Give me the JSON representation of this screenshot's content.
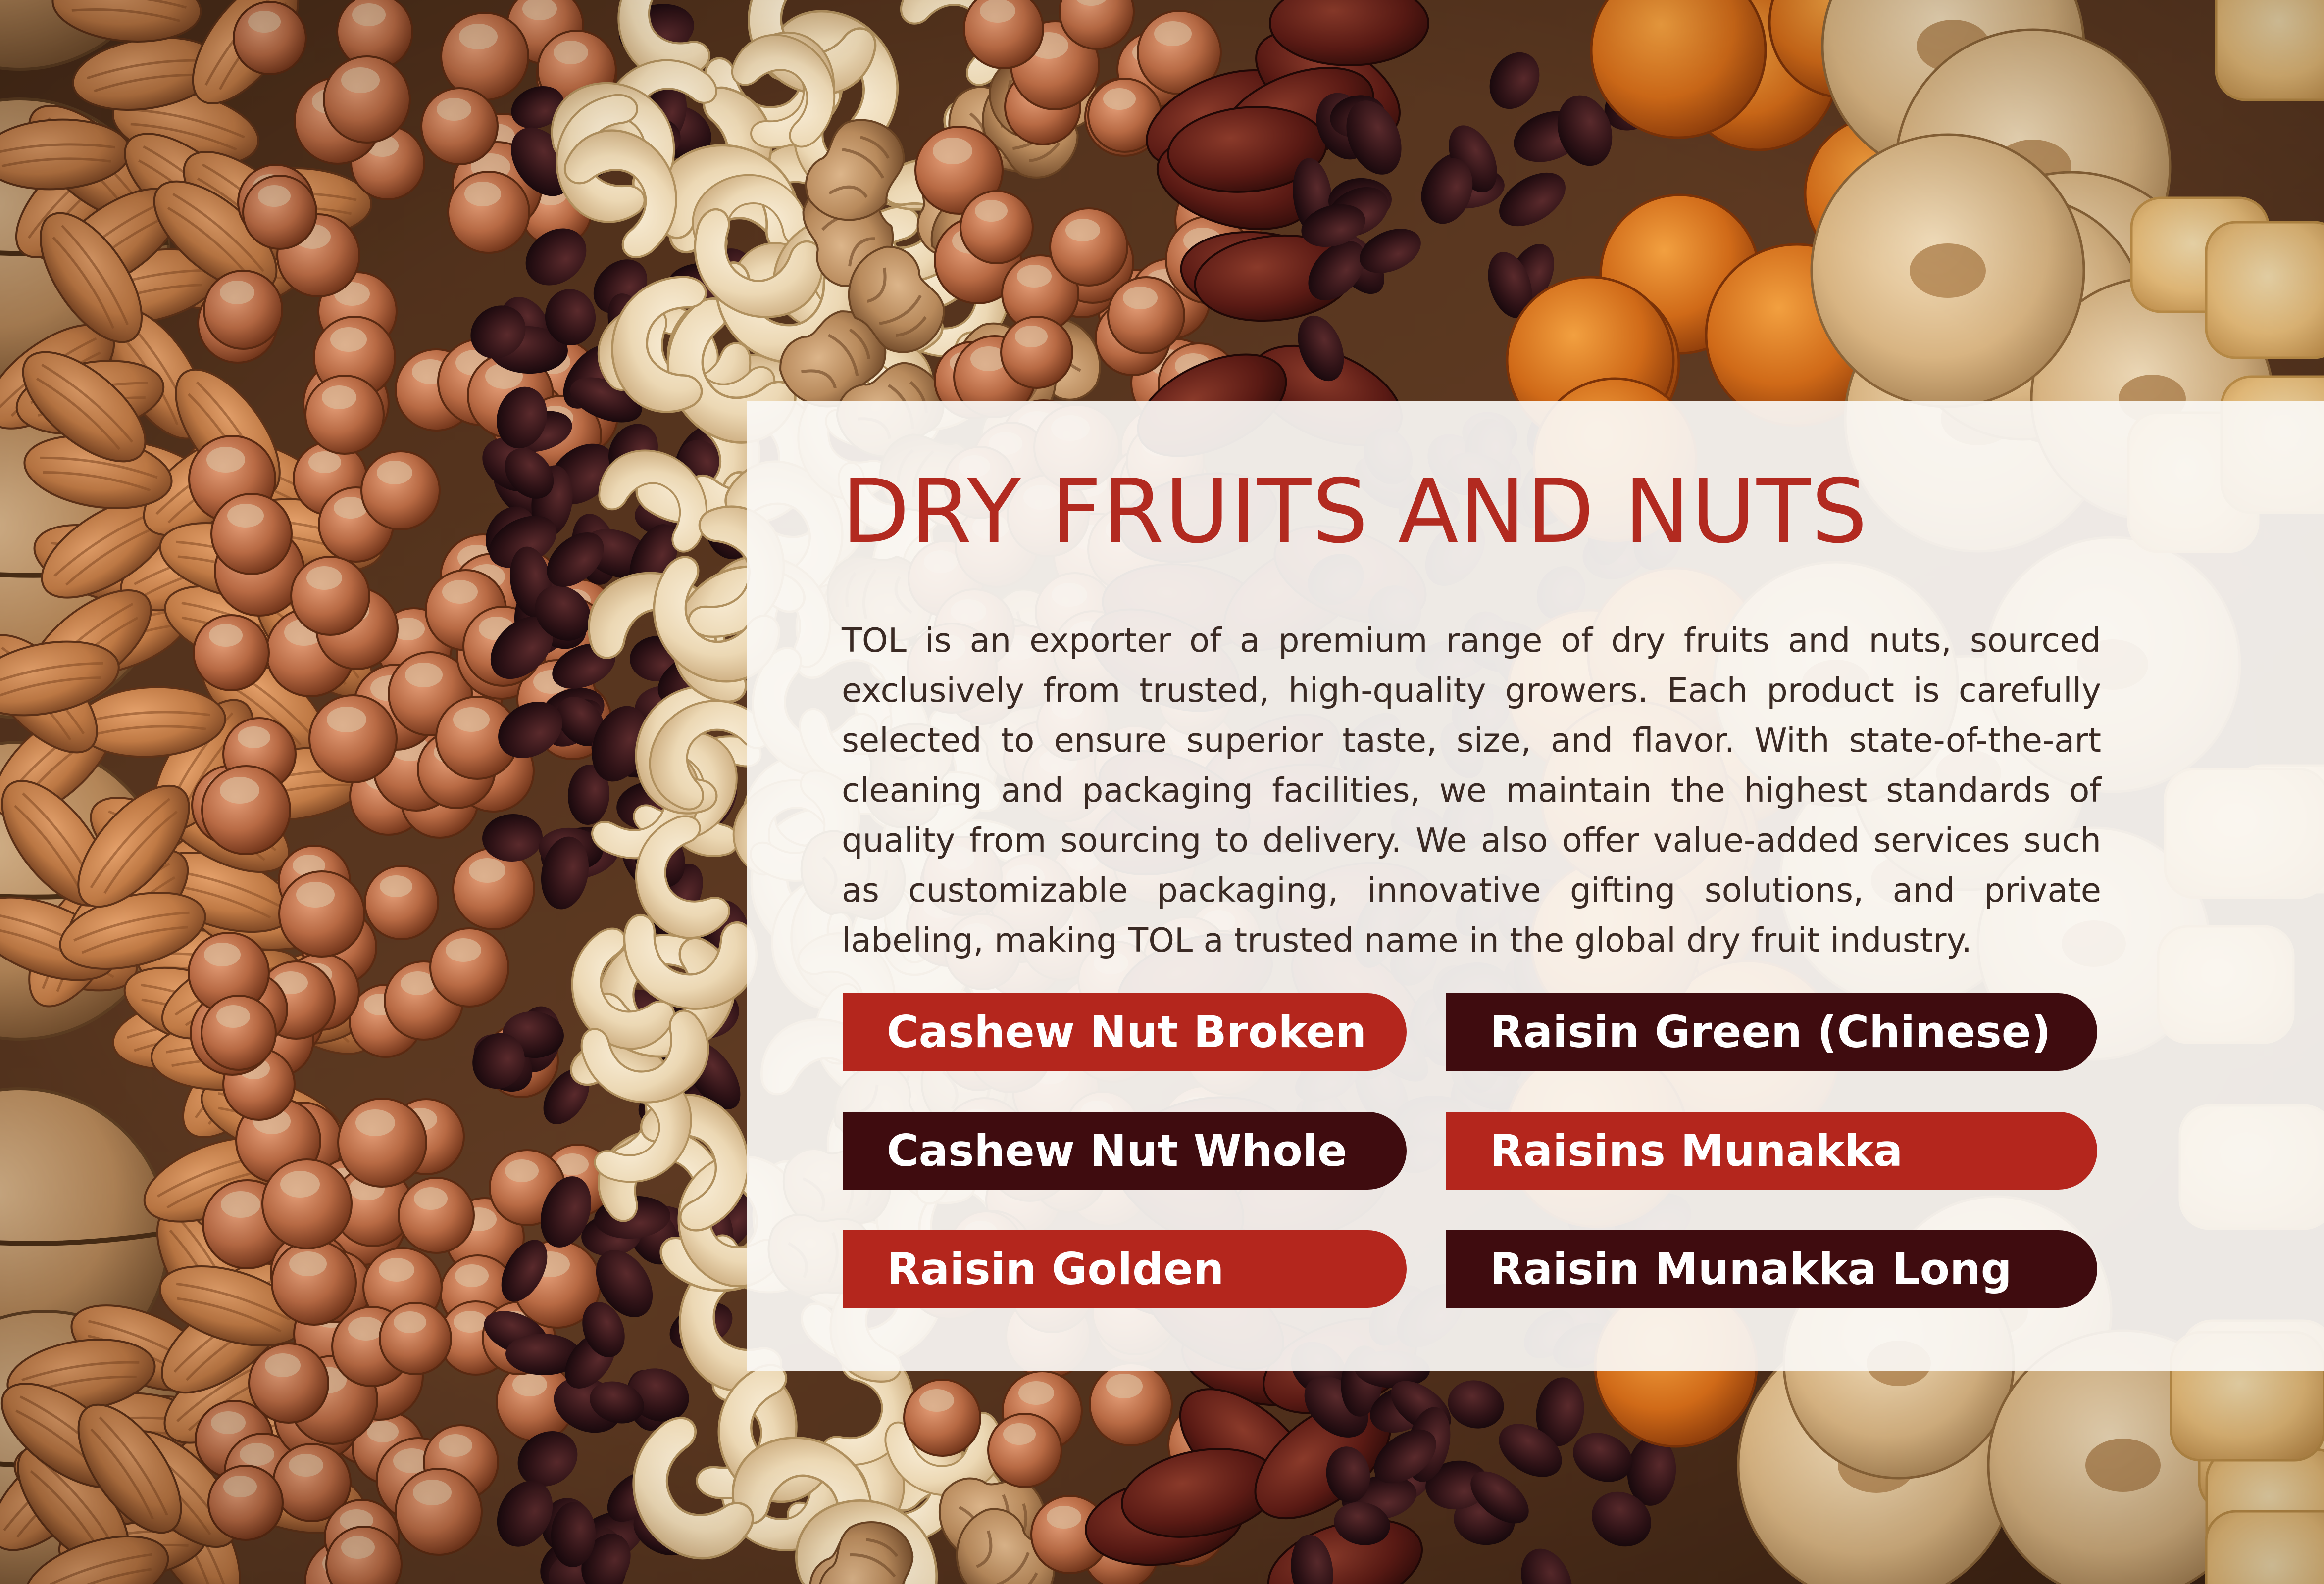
{
  "colors": {
    "title": "#b22a20",
    "text": "#3a2a24",
    "tag_red": "#b4261d",
    "tag_maroon": "#3f0c0f",
    "card_background": "#faf7f4"
  },
  "background": {
    "image_description": "top-down mix of almonds, walnuts, hazelnuts, raisins, cashews, dates, dried apricots, dried figs and candied ginger"
  },
  "card": {
    "title": "DRY FRUITS AND NUTS",
    "description": "TOL is an exporter of a premium range of dry fruits and nuts, sourced exclusively from trusted, high-quality growers. Each product is carefully selected to ensure superior taste, size, and flavor. With state-of-the-art cleaning and packaging facilities, we maintain the highest standards of quality from sourcing to delivery. We also offer value-added services such as customizable packaging, innovative gifting solutions, and private labeling, making TOL a trusted name in the global dry fruit industry.",
    "products": [
      {
        "label": "Cashew Nut Broken",
        "color": "#b4261d"
      },
      {
        "label": "Raisin Green (Chinese)",
        "color": "#3f0c0f"
      },
      {
        "label": "Cashew Nut Whole",
        "color": "#3f0c0f"
      },
      {
        "label": "Raisins Munakka",
        "color": "#b4261d"
      },
      {
        "label": "Raisin Golden",
        "color": "#b4261d"
      },
      {
        "label": "Raisin Munakka Long",
        "color": "#3f0c0f"
      }
    ]
  }
}
